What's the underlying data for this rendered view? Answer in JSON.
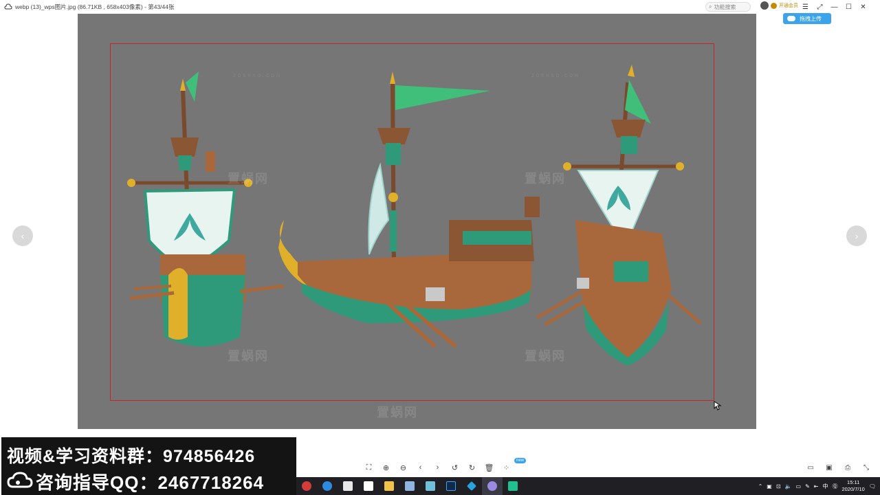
{
  "window": {
    "title": "webp (13)_wps图片.jpg (86.71KB , 658x403像素) - 第43/44张",
    "search_placeholder": "功能搜索",
    "vip_label": "开通会员",
    "upload_label": "拖拽上传"
  },
  "viewer": {
    "watermark_text": "置蜗网",
    "watermark_sub": "ZOSHSO.COM",
    "nav_prev": "‹",
    "nav_next": "›"
  },
  "toolbar": {
    "new_badge": "new"
  },
  "overlay": {
    "line1": "视频&学习资料群：974856426",
    "line2": "咨询指导QQ：2467718264"
  },
  "taskbar": {
    "time": "15:11",
    "date": "2020/7/10",
    "ime_label": "中"
  },
  "colors": {
    "viewer_bg": "#767676",
    "selection": "#c6242a",
    "accent": "#3ba3ec",
    "sail_green": "#3fbf7a",
    "hull_green": "#2f9a7a",
    "wood": "#a8683c",
    "gold": "#e0b02a"
  }
}
